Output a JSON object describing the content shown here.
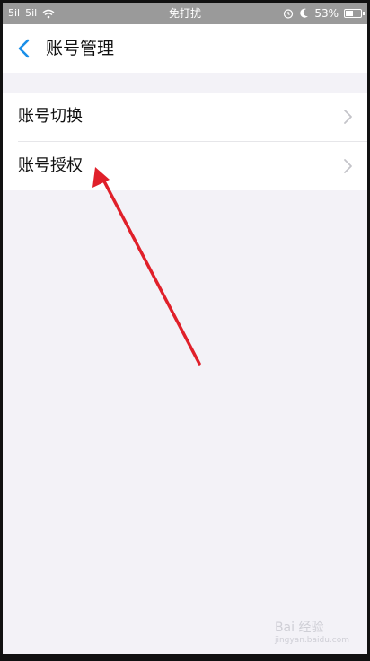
{
  "status_bar": {
    "signal1": "5il",
    "signal2": "5il",
    "center_text": "免打扰",
    "battery_text": "53%",
    "battery_level": 0.53,
    "icons": [
      "alarm-icon",
      "moon-icon",
      "wifi-icon",
      "battery-icon"
    ]
  },
  "nav": {
    "title": "账号管理",
    "back_icon": "chevron-left-icon"
  },
  "list": {
    "items": [
      {
        "label": "账号切换"
      },
      {
        "label": "账号授权"
      }
    ]
  },
  "annotation": {
    "arrow_color": "#e0202a"
  },
  "watermark": {
    "text": "Bai 经验",
    "sub": "jingyan.baidu.com"
  },
  "colors": {
    "accent": "#1a8fe8",
    "background": "#f3f2f7"
  }
}
